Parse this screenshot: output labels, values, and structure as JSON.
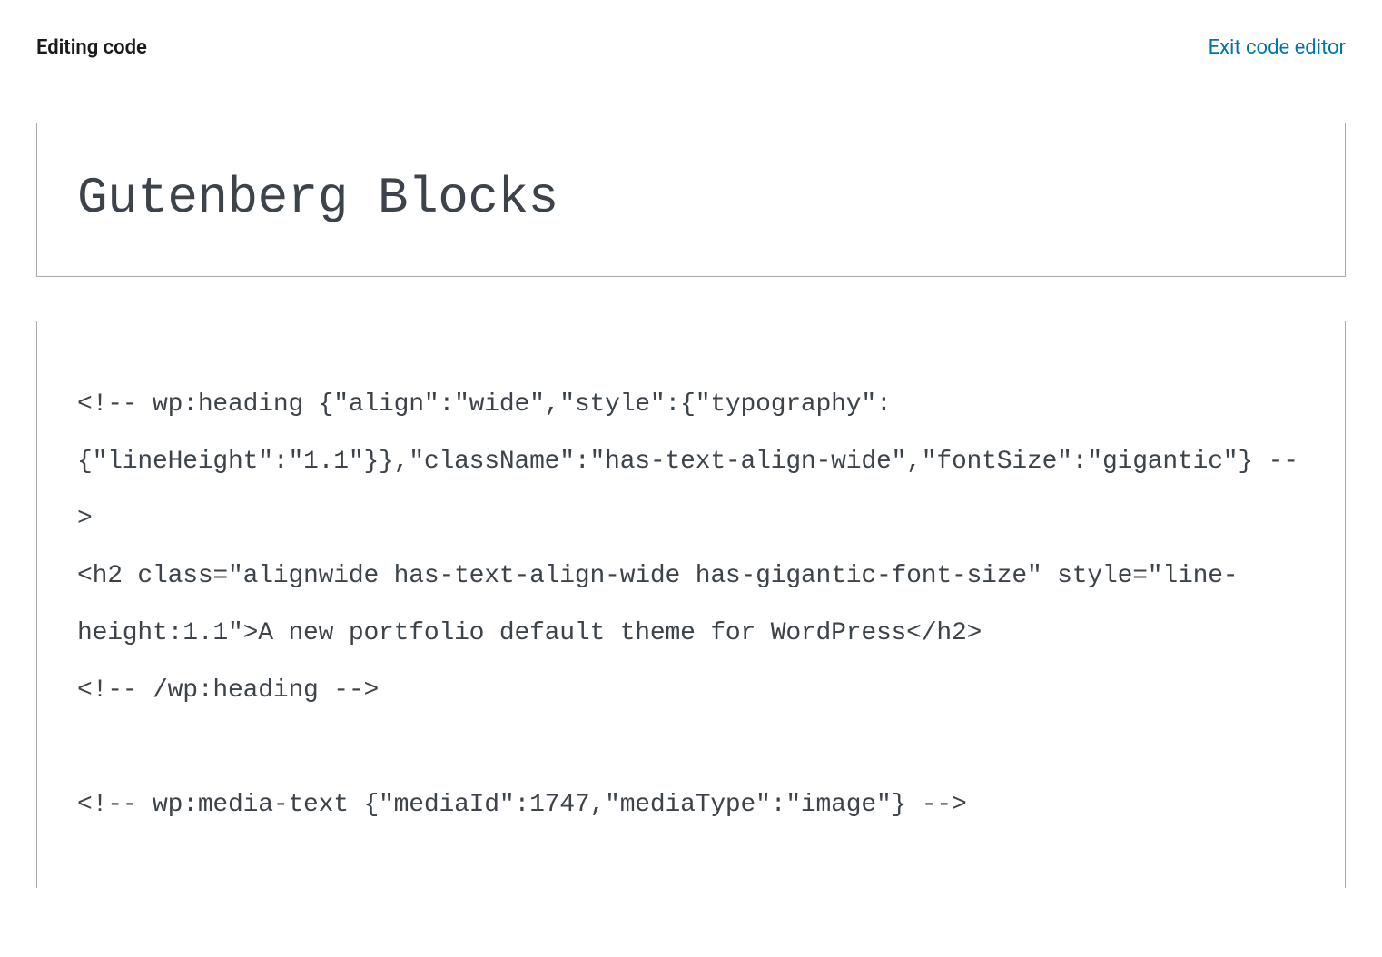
{
  "header": {
    "title": "Editing code",
    "exit_link": "Exit code editor"
  },
  "editor": {
    "post_title": "Gutenberg Blocks",
    "code_content": "<!-- wp:heading {\"align\":\"wide\",\"style\":{\"typography\":{\"lineHeight\":\"1.1\"}},\"className\":\"has-text-align-wide\",\"fontSize\":\"gigantic\"} -->\n<h2 class=\"alignwide has-text-align-wide has-gigantic-font-size\" style=\"line-height:1.1\">A new portfolio default theme for WordPress</h2>\n<!-- /wp:heading -->\n\n<!-- wp:media-text {\"mediaId\":1747,\"mediaType\":\"image\"} -->"
  }
}
